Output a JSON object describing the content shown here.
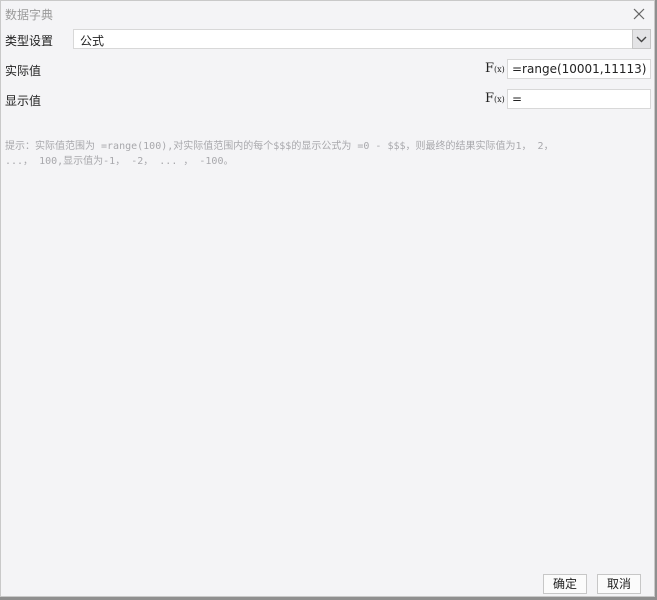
{
  "dialog": {
    "title": "数据字典",
    "type_label": "类型设置",
    "type_value": "公式",
    "actual_label": "实际值",
    "actual_formula": "=range(10001,11113)",
    "display_label": "显示值",
    "display_formula": "=",
    "fx_f": "F",
    "fx_x": "(x)",
    "hint_line1": "提示：实际值范围为 =range(100),对实际值范围内的每个$$$的显示公式为 =0 - $$$，则最终的结果实际值为1， 2，",
    "hint_line2": "...， 100,显示值为-1， -2， ... ， -100。",
    "ok_label": "确定",
    "cancel_label": "取消"
  },
  "icons": {
    "close": "close-icon",
    "dropdown": "chevron-down-icon",
    "formula": "fx-icon"
  }
}
